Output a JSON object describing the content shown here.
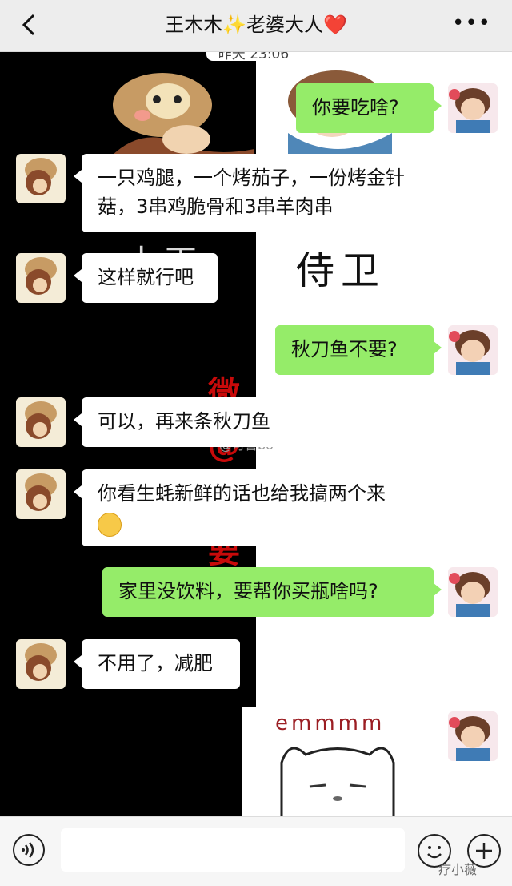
{
  "header": {
    "back_icon": "back-chevron-icon",
    "title_prefix_icon": "dancer-emoji",
    "title": "王木木✨老婆大人❤️",
    "more_icon": "more-dots-icon",
    "more_label": "•••"
  },
  "wallpaper": {
    "time_label": "昨天 23:06",
    "big_text": "侍卫",
    "half_text": "七王",
    "red_text": "微 @ 不 要",
    "watermark": "@可喜bo",
    "sticker_text": "emmmm"
  },
  "messages": [
    {
      "side": "right",
      "text": "你要吃啥?"
    },
    {
      "side": "left",
      "text": "一只鸡腿，一个烤茄子，一份烤金针菇，3串鸡脆骨和3串羊肉串"
    },
    {
      "side": "left",
      "text": "这样就行吧"
    },
    {
      "side": "right",
      "text": "秋刀鱼不要?"
    },
    {
      "side": "left",
      "text": "可以，再来条秋刀鱼"
    },
    {
      "side": "left",
      "text": "你看生蚝新鲜的话也给我搞两个来"
    },
    {
      "side": "right",
      "text": "家里没饮料，要帮你买瓶啥吗?"
    },
    {
      "side": "left",
      "text": "不用了，减肥"
    }
  ],
  "input_bar": {
    "voice_icon": "voice-icon",
    "emoji_icon": "emoji-icon",
    "plus_icon": "plus-icon",
    "watermark": "疗小薇"
  },
  "colors": {
    "my_bubble": "#95ec69",
    "their_bubble": "#ffffff",
    "header_bg": "#ededed"
  }
}
